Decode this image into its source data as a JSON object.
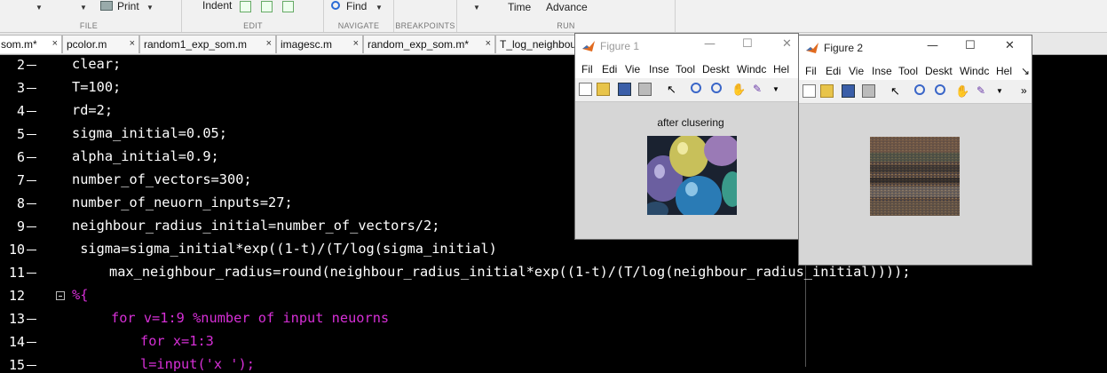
{
  "ribbon": {
    "print_label": "Print",
    "indent_label": "Indent",
    "find_label": "Find",
    "time_label": "Time",
    "advance_label": "Advance",
    "groups": {
      "file": "FILE",
      "edit": "EDIT",
      "navigate": "NAVIGATE",
      "breakpoints": "BREAKPOINTS",
      "run": "RUN"
    }
  },
  "tabs": [
    {
      "label": "som.m*"
    },
    {
      "label": "pcolor.m"
    },
    {
      "label": "random1_exp_som.m"
    },
    {
      "label": "imagesc.m"
    },
    {
      "label": "random_exp_som.m*"
    },
    {
      "label": "T_log_neighbou"
    }
  ],
  "tab_close_glyph": "×",
  "editor": {
    "line_numbers": [
      "2",
      "3",
      "4",
      "5",
      "6",
      "7",
      "8",
      "9",
      "10",
      "11",
      "12",
      "13",
      "14",
      "15"
    ],
    "lines": [
      "clear;",
      "T=100;",
      "rd=2;",
      "sigma_initial=0.05;",
      "alpha_initial=0.9;",
      "number_of_vectors=300;",
      "number_of_neuorn_inputs=27;",
      "neighbour_radius_initial=number_of_vectors/2;",
      " sigma=sigma_initial*exp((1-t)/(T/log(sigma_initial)",
      "max_neighbour_radius=round(neighbour_radius_initial*exp((1-t)/(T/log(neighbour_radius_initial))));",
      "%{",
      "for v=1:9 %number of input neuorns",
      "for x=1:3",
      "l=input('x ');"
    ],
    "keyword_color": "#d62fd6"
  },
  "figure1": {
    "title": "Figure 1",
    "menus": [
      "File",
      "Edit",
      "View",
      "Insert",
      "Tools",
      "Desktop",
      "Window",
      "Help"
    ],
    "menus_display": [
      "Fil",
      "Edi",
      "Vie",
      "Inse",
      "Tool",
      "Deskt",
      "Windc",
      "Hel"
    ],
    "plot_title": "after clusering",
    "image_name": "balloons-image"
  },
  "figure2": {
    "title": "Figure 2",
    "menus_display": [
      "Fil",
      "Edi",
      "Vie",
      "Inse",
      "Tool",
      "Deskt",
      "Windc",
      "Hel"
    ],
    "overflow_menu": "↘",
    "overflow_toolbar": "»",
    "image_name": "clustered-noise-image"
  },
  "window_controls": {
    "minimize": "—",
    "maximize": "☐",
    "close": "✕"
  },
  "colors": {
    "editor_bg": "#000000",
    "matlab_orange": "#e16a1e",
    "figure_bg": "#d6d6d6"
  }
}
